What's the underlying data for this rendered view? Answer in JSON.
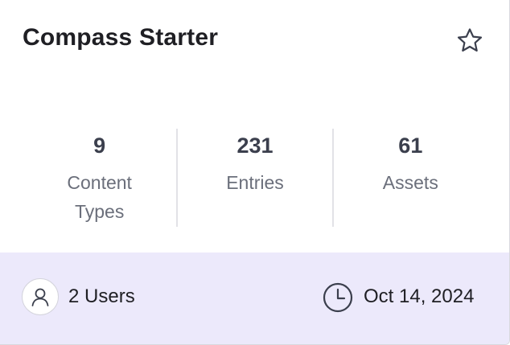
{
  "card": {
    "title": "Compass Starter",
    "favorite_icon": "star-outline-icon",
    "stats": [
      {
        "value": "9",
        "label": "Content Types"
      },
      {
        "value": "231",
        "label": "Entries"
      },
      {
        "value": "61",
        "label": "Assets"
      }
    ],
    "footer": {
      "users_icon": "user-icon",
      "users_label": "2 Users",
      "date_icon": "clock-icon",
      "date_label": "Oct 14, 2024"
    }
  },
  "colors": {
    "footer_bg": "#ece9fb",
    "title": "#1f1f24",
    "stat_value": "#3b3f4d",
    "stat_label": "#6b6f7b"
  }
}
